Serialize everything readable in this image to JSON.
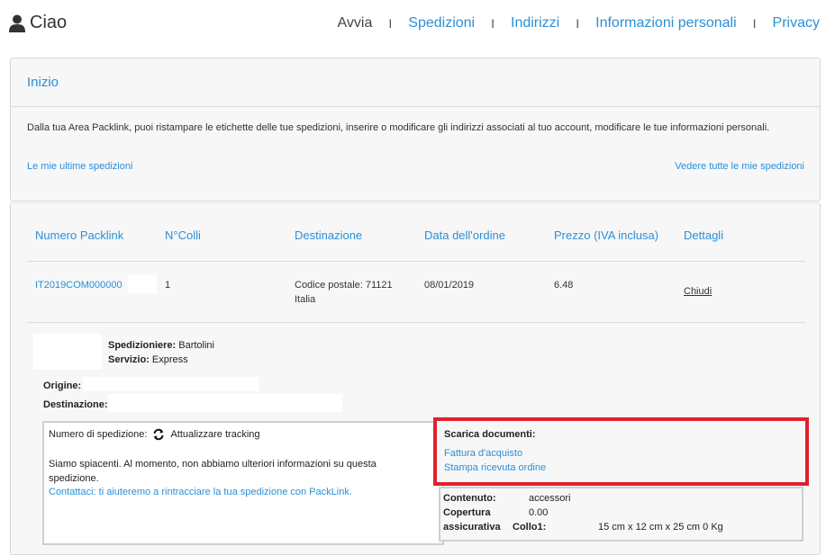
{
  "header": {
    "greeting": "Ciao",
    "nav": [
      "Avvia",
      "Spedizioni",
      "Indirizzi",
      "Informazioni personali",
      "Privacy"
    ],
    "separator": "I"
  },
  "intro": {
    "title": "Inizio",
    "description": "Dalla tua Area Packlink, puoi ristampare le etichette delle tue spedizioni, inserire o modificare gli indirizzi associati al tuo account, modificare le tue informazioni personali.",
    "recent_link": "Le mie ultime spedizioni",
    "all_link": "Vedere tutte le mie spedizioni"
  },
  "shipments_table": {
    "columns": [
      "Numero Packlink",
      "N°Colli",
      "Destinazione",
      "Data dell'ordine",
      "Prezzo (IVA inclusa)",
      "Dettagli"
    ],
    "row": {
      "packlink_number": "IT2019COM000000",
      "parcels": "1",
      "destination_line1": "Codice postale: 71121",
      "destination_line2": "Italia",
      "order_date": "08/01/2019",
      "price": "6.48",
      "details_link": "Chiudi"
    }
  },
  "details": {
    "carrier_label": "Spedizioniere:",
    "carrier_value": "Bartolini",
    "service_label": "Servizio:",
    "service_value": "Express",
    "origin_label": "Origine:",
    "destination_label": "Destinazione:",
    "tracking": {
      "label": "Numero di spedizione:",
      "update_link": "Attualizzare tracking",
      "message": "Siamo spiacenti. Al momento, non abbiamo ulteriori informazioni su questa spedizione.",
      "contact_link": "Contattaci: ti aiuteremo a rintracciare la tua spedizione con PackLink."
    },
    "documents": {
      "title": "Scarica documenti:",
      "invoice_link": "Fattura d'acquisto",
      "receipt_link": "Stampa ricevuta ordine"
    },
    "content": {
      "content_label": "Contenuto:",
      "content_value": "accessori",
      "insurance_label_1": "Copertura",
      "insurance_label_2": "assicurativa",
      "insurance_value": "0.00",
      "package_label": "Collo1:",
      "package_value": "15 cm x 12 cm x 25 cm 0 Kg"
    }
  },
  "colors": {
    "accent": "#2b8fd6",
    "highlight": "#e0202a",
    "panel_bg": "#f7f7f7"
  }
}
